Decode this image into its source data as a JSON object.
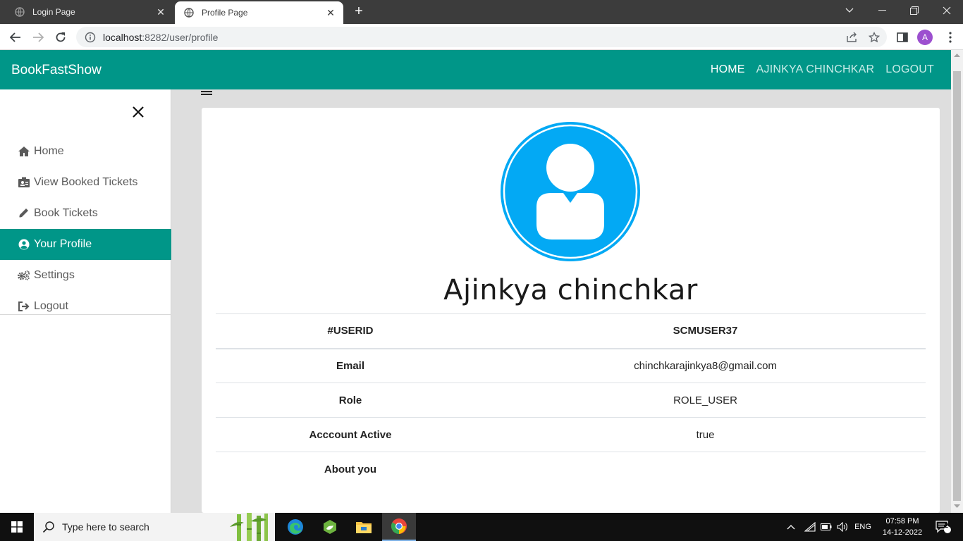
{
  "browser": {
    "tabs": [
      {
        "title": "Login Page",
        "active": false
      },
      {
        "title": "Profile Page",
        "active": true
      }
    ],
    "url_host": "localhost",
    "url_rest": ":8282/user/profile",
    "profile_initial": "A"
  },
  "navbar": {
    "brand": "BookFastShow",
    "links": [
      "HOME",
      "AJINKYA CHINCHKAR",
      "LOGOUT"
    ]
  },
  "sidebar": {
    "items": [
      {
        "label": "Home",
        "icon": "home-icon"
      },
      {
        "label": "View Booked Tickets",
        "icon": "ticket-icon"
      },
      {
        "label": "Book Tickets",
        "icon": "pencil-icon"
      },
      {
        "label": "Your Profile",
        "icon": "user-circle-icon",
        "active": true
      },
      {
        "label": "Settings",
        "icon": "gears-icon"
      },
      {
        "label": "Logout",
        "icon": "sign-out-icon"
      }
    ]
  },
  "profile": {
    "name": "Ajinkya chinchkar",
    "header": {
      "label": "#USERID",
      "value": "SCMUSER37"
    },
    "rows": [
      {
        "label": "Email",
        "value": "chinchkarajinkya8@gmail.com"
      },
      {
        "label": "Role",
        "value": "ROLE_USER"
      },
      {
        "label": "Acccount Active",
        "value": "true"
      },
      {
        "label": "About you",
        "value": ""
      }
    ]
  },
  "taskbar": {
    "search_placeholder": "Type here to search",
    "language": "ENG",
    "time": "07:58 PM",
    "date": "14-12-2022",
    "notification_count": "2"
  },
  "colors": {
    "primary": "#009688",
    "avatar_blue": "#03a9f4"
  }
}
